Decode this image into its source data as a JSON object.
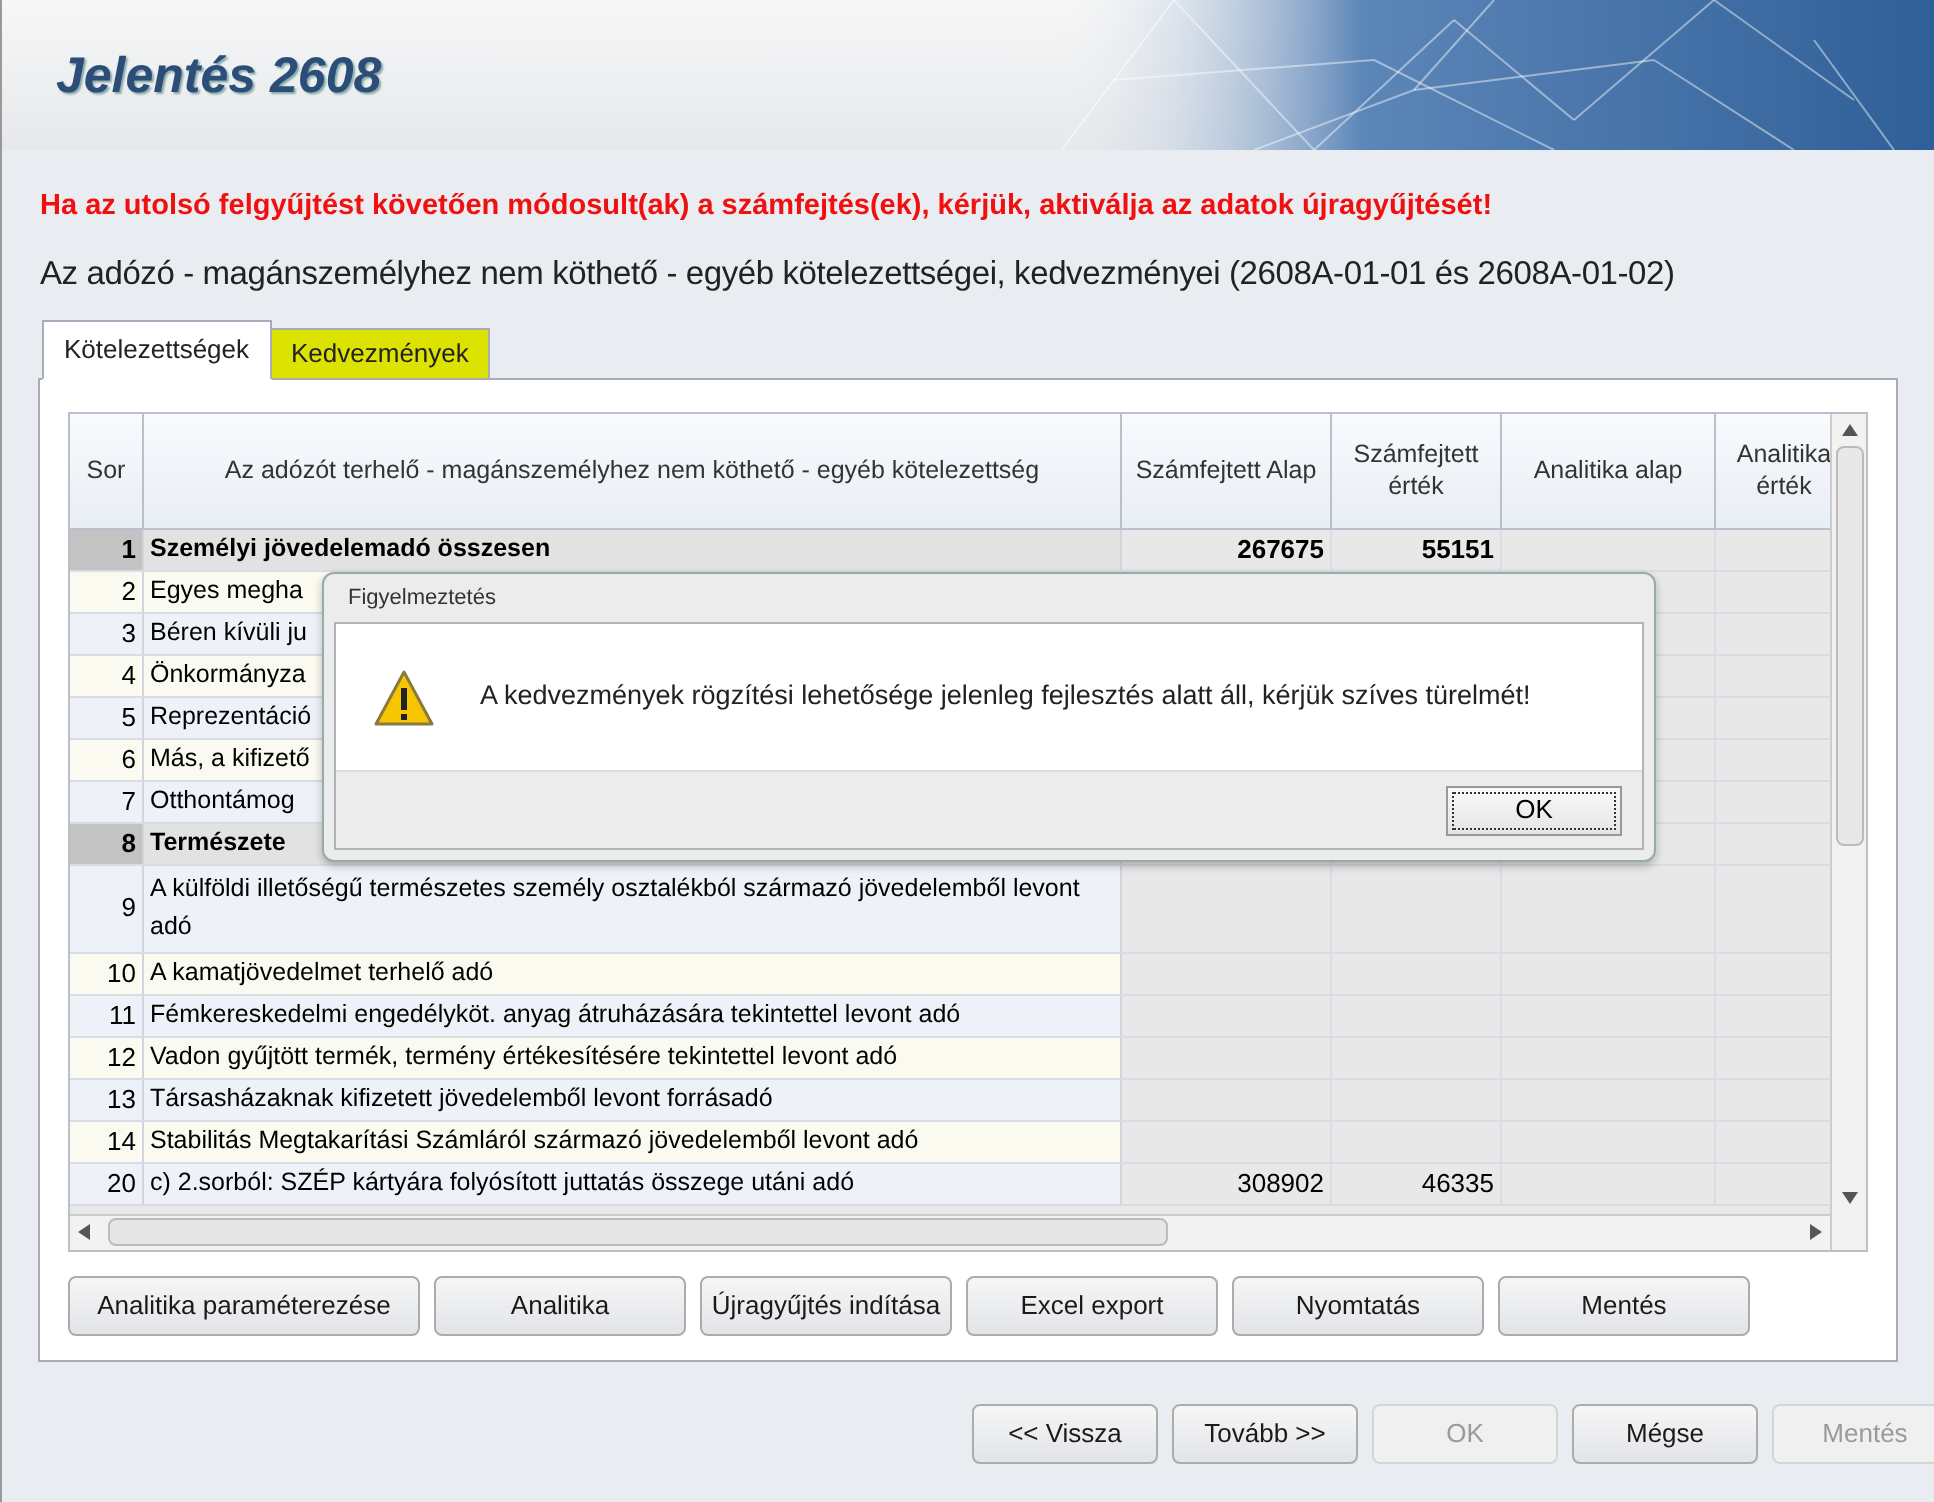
{
  "header": {
    "title": "Jelentés 2608"
  },
  "warning": "Ha az utolsó felgyűjtést követően módosult(ak) a számfejtés(ek), kérjük, aktiválja az adatok újragyűjtését!",
  "subtitle": "Az adózó - magánszemélyhez nem köthető - egyéb kötelezettségei, kedvezményei (2608A-01-01 és 2608A-01-02)",
  "tabs": [
    {
      "label": "Kötelezettségek",
      "selected": true,
      "highlighted": false
    },
    {
      "label": "Kedvezmények",
      "selected": false,
      "highlighted": true
    }
  ],
  "table": {
    "columns": [
      "Sor",
      "Az adózót terhelő - magánszemélyhez nem köthető - egyéb kötelezettség",
      "Számfejtett Alap",
      "Számfejtett érték",
      "Analitika alap",
      "Analitika érték"
    ],
    "rows": [
      {
        "kind": "total",
        "sor": "1",
        "label": "Személyi jövedelemadó összesen",
        "alap": "267675",
        "ertek": "55151"
      },
      {
        "kind": "item",
        "sor": "2",
        "label": "Egyes megha"
      },
      {
        "kind": "item",
        "sor": "3",
        "label": "Béren kívüli ju"
      },
      {
        "kind": "item",
        "sor": "4",
        "label": "Önkormányza"
      },
      {
        "kind": "item",
        "sor": "5",
        "label": "Reprezentáció"
      },
      {
        "kind": "item",
        "sor": "6",
        "label": "Más, a kifizető"
      },
      {
        "kind": "item",
        "sor": "7",
        "label": "Otthontámog"
      },
      {
        "kind": "total",
        "sor": "8",
        "label": "Természete"
      },
      {
        "kind": "item",
        "sor": "9",
        "label": "A külföldi illetőségű természetes személy osztalékból származó jövedelemből levont adó"
      },
      {
        "kind": "item",
        "sor": "10",
        "label": "A kamatjövedelmet terhelő adó"
      },
      {
        "kind": "item",
        "sor": "11",
        "label": "Fémkereskedelmi engedélyköt. anyag átruházására tekintettel levont adó"
      },
      {
        "kind": "item",
        "sor": "12",
        "label": "Vadon gyűjtött termék, termény értékesítésére tekintettel levont adó"
      },
      {
        "kind": "item",
        "sor": "13",
        "label": "Társasházaknak kifizetett jövedelemből levont forrásadó"
      },
      {
        "kind": "item",
        "sor": "14",
        "label": "Stabilitás Megtakarítási Számláról származó jövedelemből levont adó"
      },
      {
        "kind": "item",
        "sor": "20",
        "label": "c) 2.sorból: SZÉP kártyára folyósított juttatás összege utáni adó",
        "alap": "308902",
        "ertek": "46335"
      }
    ]
  },
  "panel_buttons": [
    "Analitika paraméterezése",
    "Analitika",
    "Újragyűjtés indítása",
    "Excel export",
    "Nyomtatás",
    "Mentés"
  ],
  "footer_buttons": [
    {
      "label": "<< Vissza",
      "disabled": false
    },
    {
      "label": "Tovább >>",
      "disabled": false
    },
    {
      "label": "OK",
      "disabled": true
    },
    {
      "label": "Mégse",
      "disabled": false
    },
    {
      "label": "Mentés",
      "disabled": true
    }
  ],
  "dialog": {
    "title": "Figyelmeztetés",
    "message": "A kedvezmények rögzítési lehetősége jelenleg fejlesztés alatt áll, kérjük szíves türelmét!",
    "button": "OK"
  }
}
